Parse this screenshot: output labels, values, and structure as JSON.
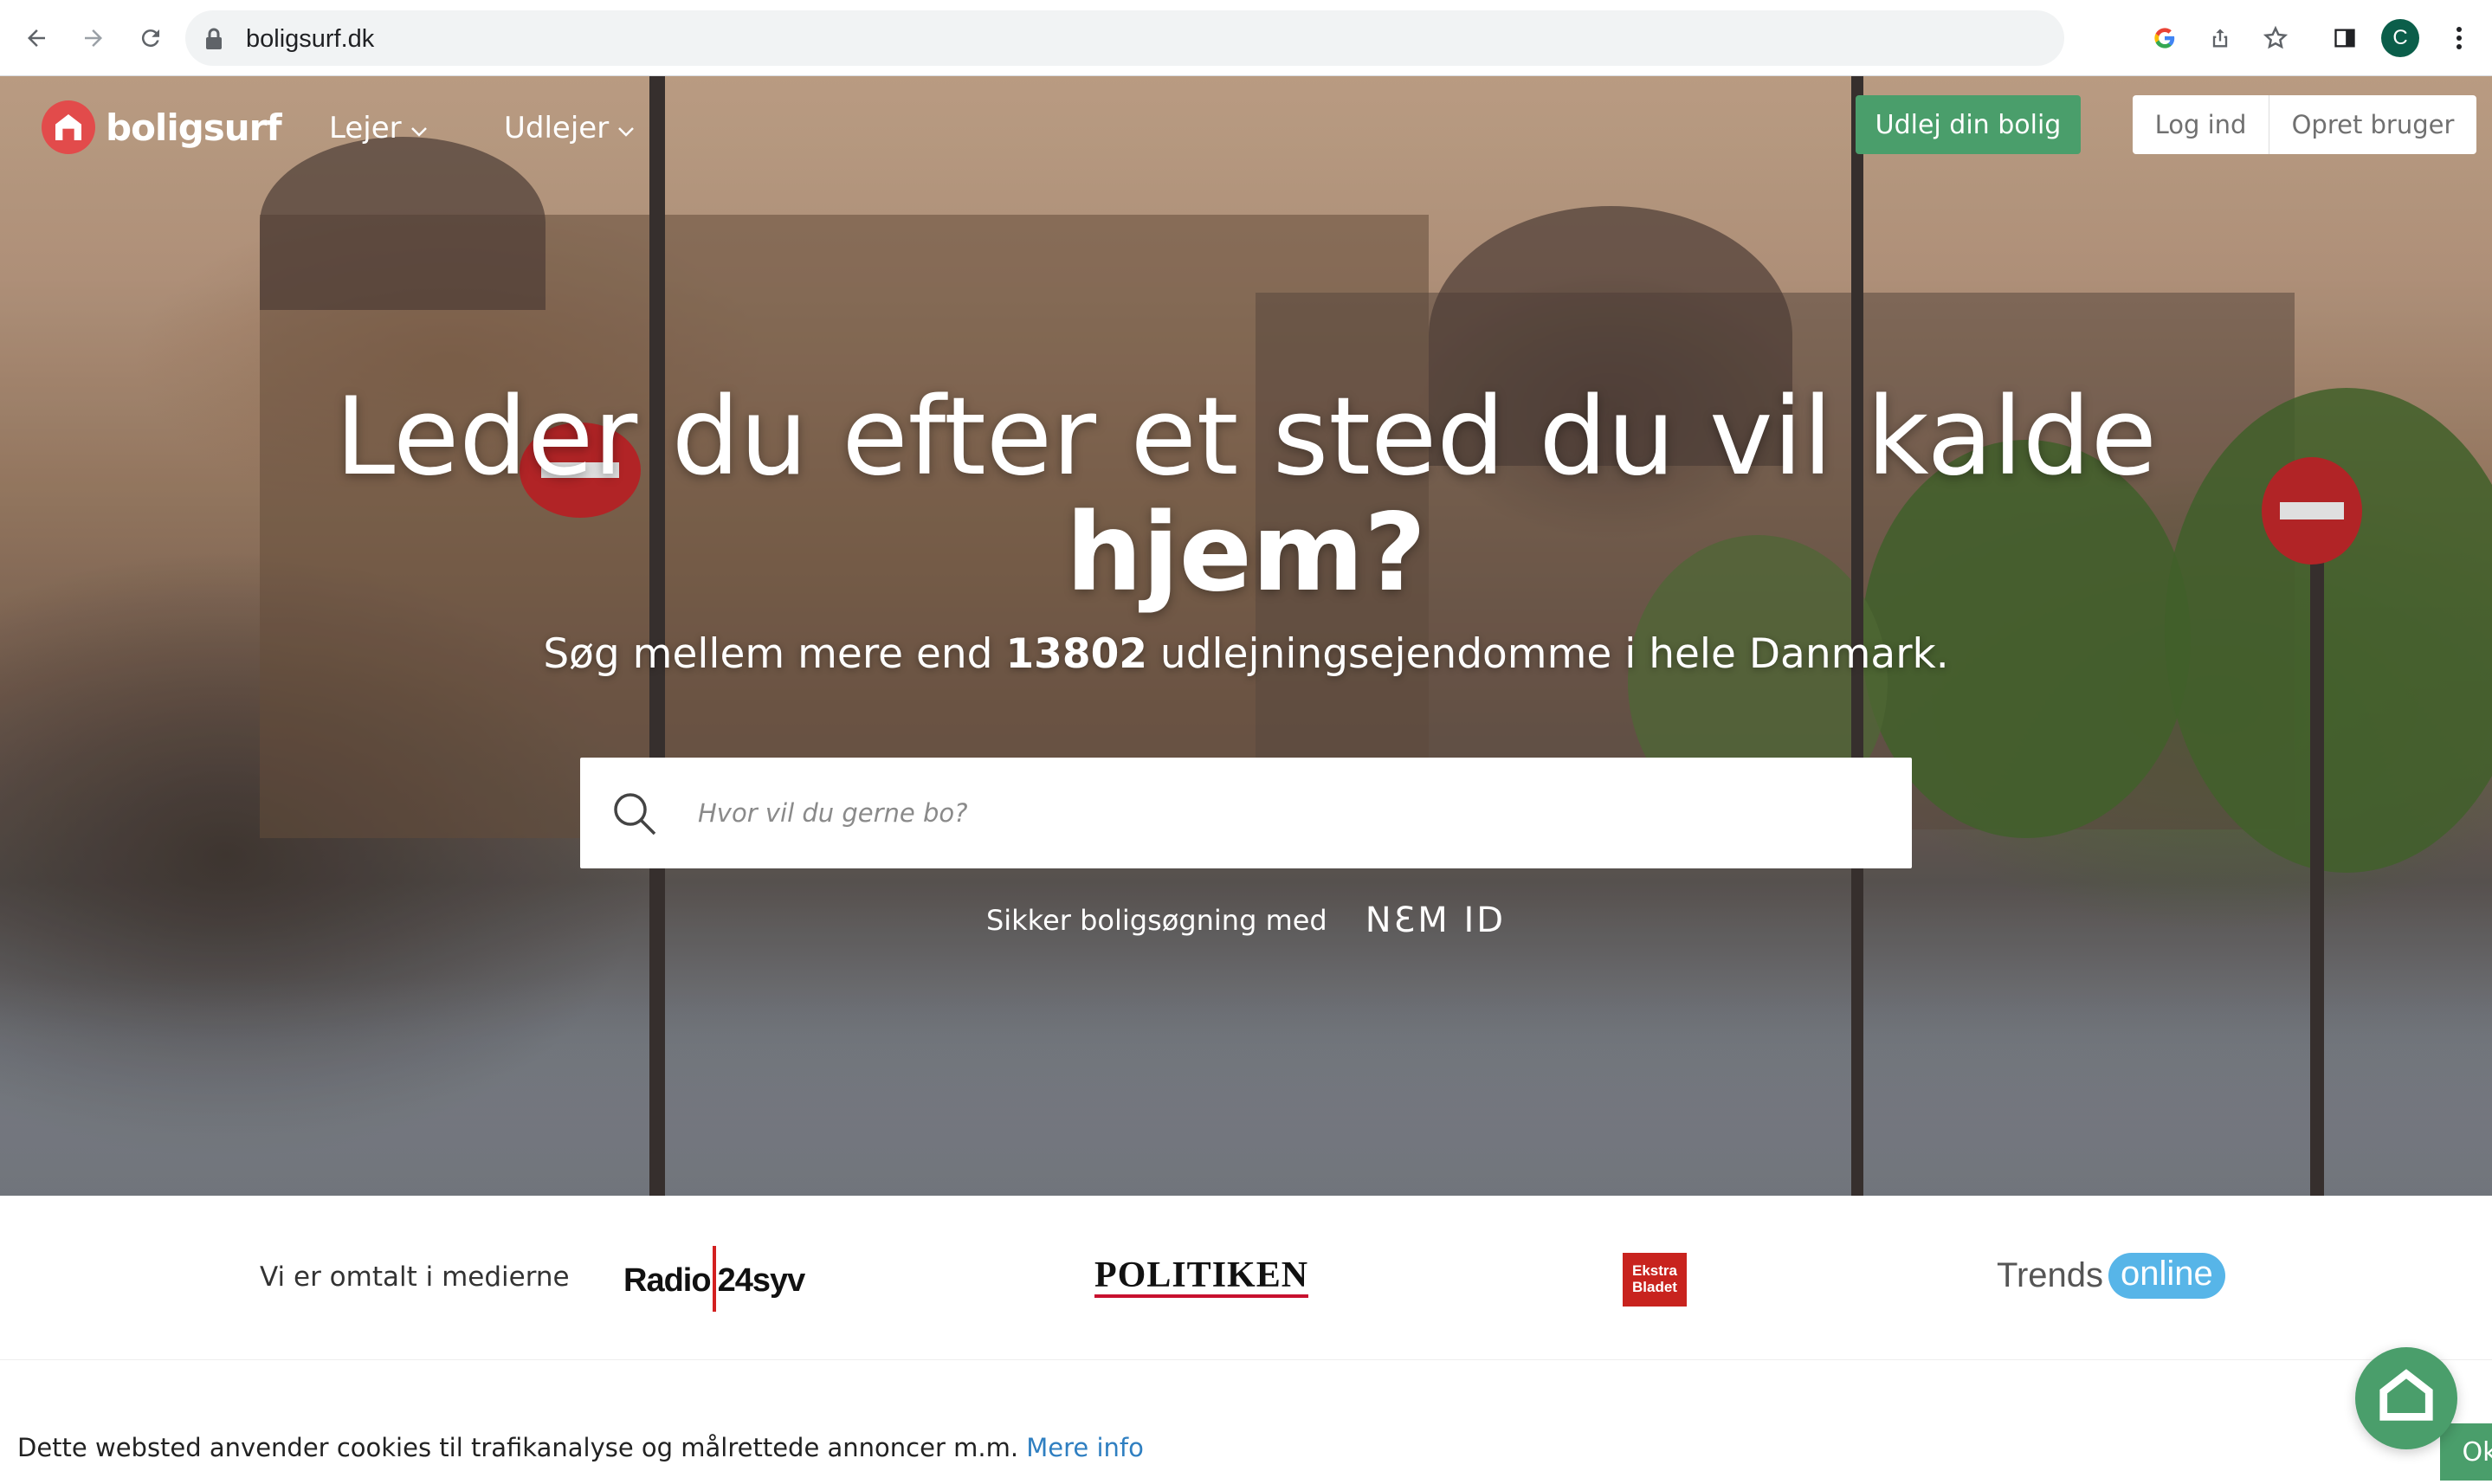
{
  "browser": {
    "url": "boligsurf.dk",
    "profile_initial": "C",
    "icons": [
      "back-icon",
      "forward-icon",
      "reload-icon",
      "lock-icon",
      "google-icon",
      "share-icon",
      "bookmark-star-icon",
      "side-panel-icon",
      "kebab-menu-icon"
    ]
  },
  "site": {
    "logo_text": "boligsurf",
    "nav": {
      "lejer": "Lejer",
      "udlejer": "Udlejer"
    },
    "cta_label": "Udlej din bolig",
    "login_label": "Log ind",
    "signup_label": "Opret bruger"
  },
  "hero": {
    "headline_line1": "Leder du efter et sted du vil kalde",
    "headline_line2": "hjem?",
    "sub_prefix": "Søg mellem mere end ",
    "sub_count": "13802",
    "sub_suffix": " udlejningsejendomme i hele Danmark.",
    "search_placeholder": "Hvor vil du gerne bo?",
    "secure_text": "Sikker boligsøgning med",
    "nemid_logo": "NƐM ID"
  },
  "media": {
    "label": "Vi er omtalt i medierne",
    "radio_left": "Radio",
    "radio_right": "24syv",
    "politiken": "POLITIKEN",
    "ekstra_line1": "Ekstra",
    "ekstra_line2": "Bladet",
    "trends_word": "Trends",
    "trends_pill": "online"
  },
  "cookie": {
    "message": "Dette websted anvender cookies til trafikanalyse og målrettede annoncer m.m. ",
    "link": "Mere info",
    "ok_label": "Ok"
  },
  "colors": {
    "brand_green": "#4a9e6b",
    "logo_red": "#e24b4b",
    "link_blue": "#2f7fc1"
  }
}
